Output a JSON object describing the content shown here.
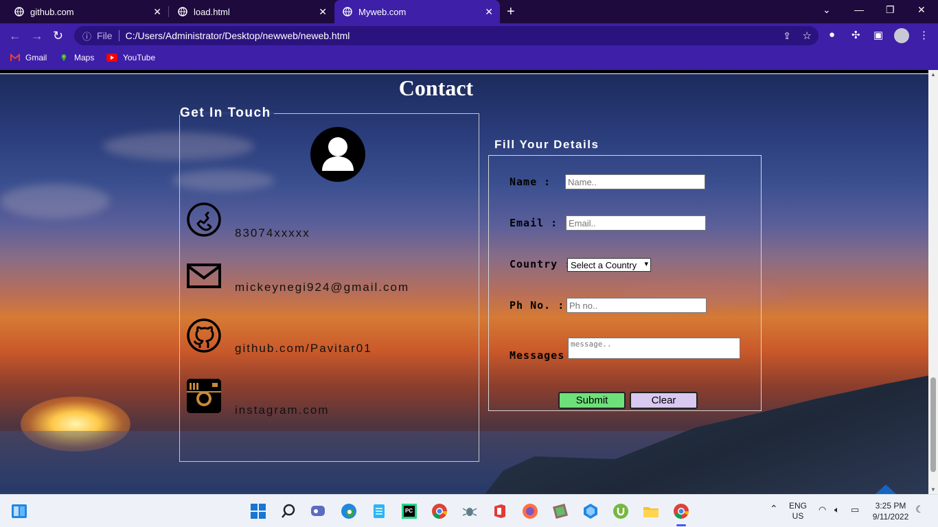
{
  "browser": {
    "tabs": [
      {
        "title": "github.com",
        "active": false
      },
      {
        "title": "load.html",
        "active": false
      },
      {
        "title": "Myweb.com",
        "active": true
      }
    ],
    "address": {
      "scheme": "File",
      "url": "C:/Users/Administrator/Desktop/newweb/neweb.html"
    },
    "bookmarks": [
      {
        "label": "Gmail",
        "icon": "gmail-icon"
      },
      {
        "label": "Maps",
        "icon": "maps-icon"
      },
      {
        "label": "YouTube",
        "icon": "youtube-icon"
      }
    ]
  },
  "page": {
    "title": "Contact",
    "get_in_touch": {
      "legend": "Get In Touch",
      "phone": "83074xxxxx",
      "email": "mickeynegi924@gmail.com",
      "github": "github.com/Pavitar01",
      "instagram": "instagram.com"
    },
    "form": {
      "legend": "Fill Your Details",
      "name_label": "Name :",
      "name_placeholder": "Name..",
      "email_label": "Email :",
      "email_placeholder": "Email..",
      "country_label": "Country :",
      "country_selected": "Select a Country",
      "phone_label": "Ph No. :",
      "phone_placeholder": "Ph no..",
      "messages_label": "Messages :",
      "message_placeholder": "message..",
      "submit_label": "Submit",
      "clear_label": "Clear"
    }
  },
  "taskbar": {
    "language": "ENG",
    "region": "US",
    "time": "3:25 PM",
    "date": "9/11/2022"
  },
  "colors": {
    "tabbar": "#1e0a3c",
    "toolbar": "#3d1fa8",
    "submit": "#6ee07a",
    "clear": "#d9c8f0"
  }
}
